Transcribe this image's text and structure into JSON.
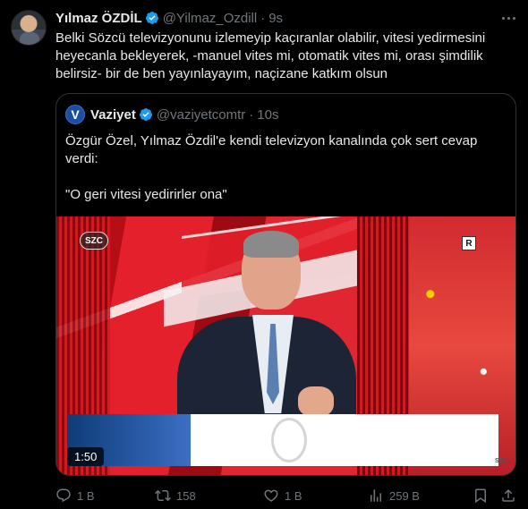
{
  "tweet": {
    "author_name": "Yılmaz ÖZDİL",
    "author_handle": "@Yilmaz_Ozdill",
    "separator": "·",
    "timestamp": "9s",
    "text": "Belki Sözcü televizyonunu izlemeyip kaçıranlar olabilir, vitesi yedirmesini heyecanla bekleyerek, -manuel vites mi, otomatik vites mi, orası şimdilik belirsiz- bir de ben yayınlayayım, naçizane katkım olsun"
  },
  "quoted_tweet": {
    "avatar_letter": "V",
    "author_name": "Vaziyet",
    "author_handle": "@vaziyetcomtr",
    "separator": "·",
    "timestamp": "10s",
    "text_line1": "Özgür Özel, Yılmaz Özdil'e kendi televizyon kanalında çok sert cevap verdi:",
    "text_line2": "\"O geri vitesi yedirirler ona\"",
    "video": {
      "channel_logo": "SZC",
      "rating_badge": "R",
      "corner_logo": "SZC",
      "duration": "1:50"
    }
  },
  "actions": {
    "reply_count": "1 B",
    "repost_count": "158",
    "like_count": "1 B",
    "view_count": "259 B"
  },
  "colors": {
    "background": "#000000",
    "text": "#e7e9ea",
    "muted": "#71767b",
    "verified": "#1d9bf0",
    "border": "#2f3336"
  },
  "icons": [
    "verified-badge-icon",
    "more-options-icon",
    "reply-icon",
    "repost-icon",
    "like-icon",
    "views-icon",
    "bookmark-icon",
    "share-icon"
  ]
}
